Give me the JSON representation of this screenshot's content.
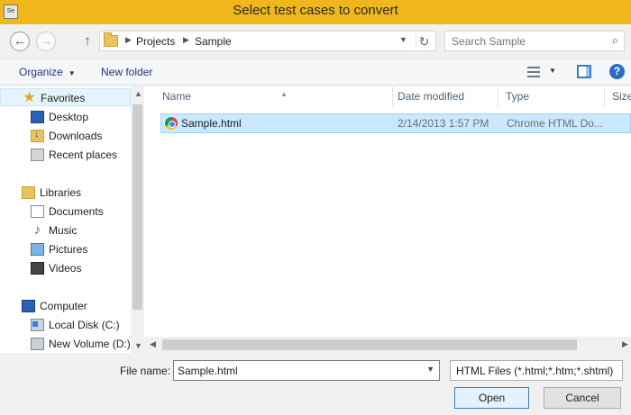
{
  "window": {
    "title": "Select test cases to convert",
    "app_icon_text": "Se"
  },
  "address": {
    "breadcrumbs": [
      "Projects",
      "Sample"
    ],
    "search_placeholder": "Search Sample"
  },
  "toolbar": {
    "organize": "Organize",
    "new_folder": "New folder",
    "help": "?"
  },
  "nav": {
    "items": [
      {
        "label": "Favorites",
        "icon": "star-icon"
      },
      {
        "label": "Desktop",
        "icon": "desktop-icon"
      },
      {
        "label": "Downloads",
        "icon": "downloads-icon"
      },
      {
        "label": "Recent places",
        "icon": "recent-places-icon"
      },
      {
        "label": "Libraries",
        "icon": "libraries-icon"
      },
      {
        "label": "Documents",
        "icon": "documents-icon"
      },
      {
        "label": "Music",
        "icon": "music-icon"
      },
      {
        "label": "Pictures",
        "icon": "pictures-icon"
      },
      {
        "label": "Videos",
        "icon": "videos-icon"
      },
      {
        "label": "Computer",
        "icon": "computer-icon"
      },
      {
        "label": "Local Disk (C:)",
        "icon": "local-disk-icon"
      },
      {
        "label": "New Volume (D:)",
        "icon": "new-volume-icon"
      }
    ]
  },
  "list": {
    "columns": [
      "Name",
      "Date modified",
      "Type",
      "Size"
    ],
    "rows": [
      {
        "name": "Sample.html",
        "date": "2/14/2013 1:57 PM",
        "type": "Chrome HTML Do..."
      }
    ]
  },
  "bottom": {
    "file_name_label": "File name:",
    "file_name_value": "Sample.html",
    "filter": "HTML Files (*.html;*.htm;*.shtml)",
    "open": "Open",
    "cancel": "Cancel"
  },
  "colors": {
    "titlebar": "#f0b71d",
    "selection": "#cce8ff",
    "link": "#1e3287"
  }
}
